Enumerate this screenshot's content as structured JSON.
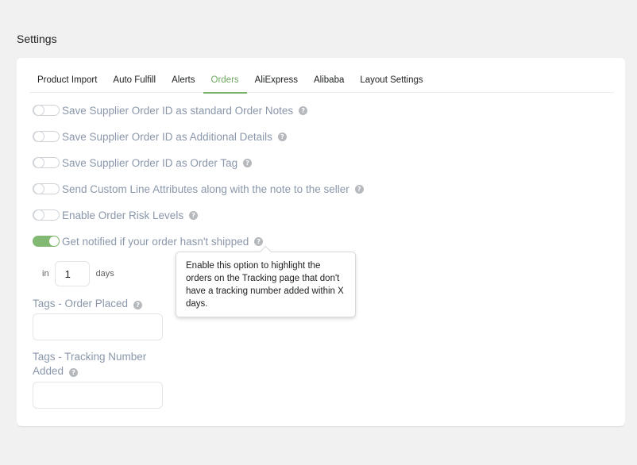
{
  "page": {
    "title": "Settings"
  },
  "tabs": [
    {
      "label": "Product Import",
      "active": false
    },
    {
      "label": "Auto Fulfill",
      "active": false
    },
    {
      "label": "Alerts",
      "active": false
    },
    {
      "label": "Orders",
      "active": true
    },
    {
      "label": "AliExpress",
      "active": false
    },
    {
      "label": "Alibaba",
      "active": false
    },
    {
      "label": "Layout Settings",
      "active": false
    }
  ],
  "toggles": [
    {
      "label": "Save Supplier Order ID as standard Order Notes",
      "on": false
    },
    {
      "label": "Save Supplier Order ID as Additional Details",
      "on": false
    },
    {
      "label": "Save Supplier Order ID as Order Tag",
      "on": false
    },
    {
      "label": "Send Custom Line Attributes along with the note to the seller",
      "on": false
    },
    {
      "label": "Enable Order Risk Levels",
      "on": false
    },
    {
      "label": "Get notified if your order hasn't shipped",
      "on": true
    }
  ],
  "days": {
    "prefix": "in",
    "value": "1",
    "suffix": "days"
  },
  "tooltip": {
    "text": "Enable this option to highlight the orders on the Tracking page that don't have a tracking number added within X days."
  },
  "fields": {
    "order_placed": {
      "label": "Tags - Order Placed",
      "value": ""
    },
    "tracking_added": {
      "label_line1": "Tags - Tracking Number",
      "label_line2": "Added",
      "value": ""
    }
  },
  "icons": {
    "help": "?"
  },
  "colors": {
    "accent": "#7cb36b",
    "label": "#8a97aa"
  }
}
